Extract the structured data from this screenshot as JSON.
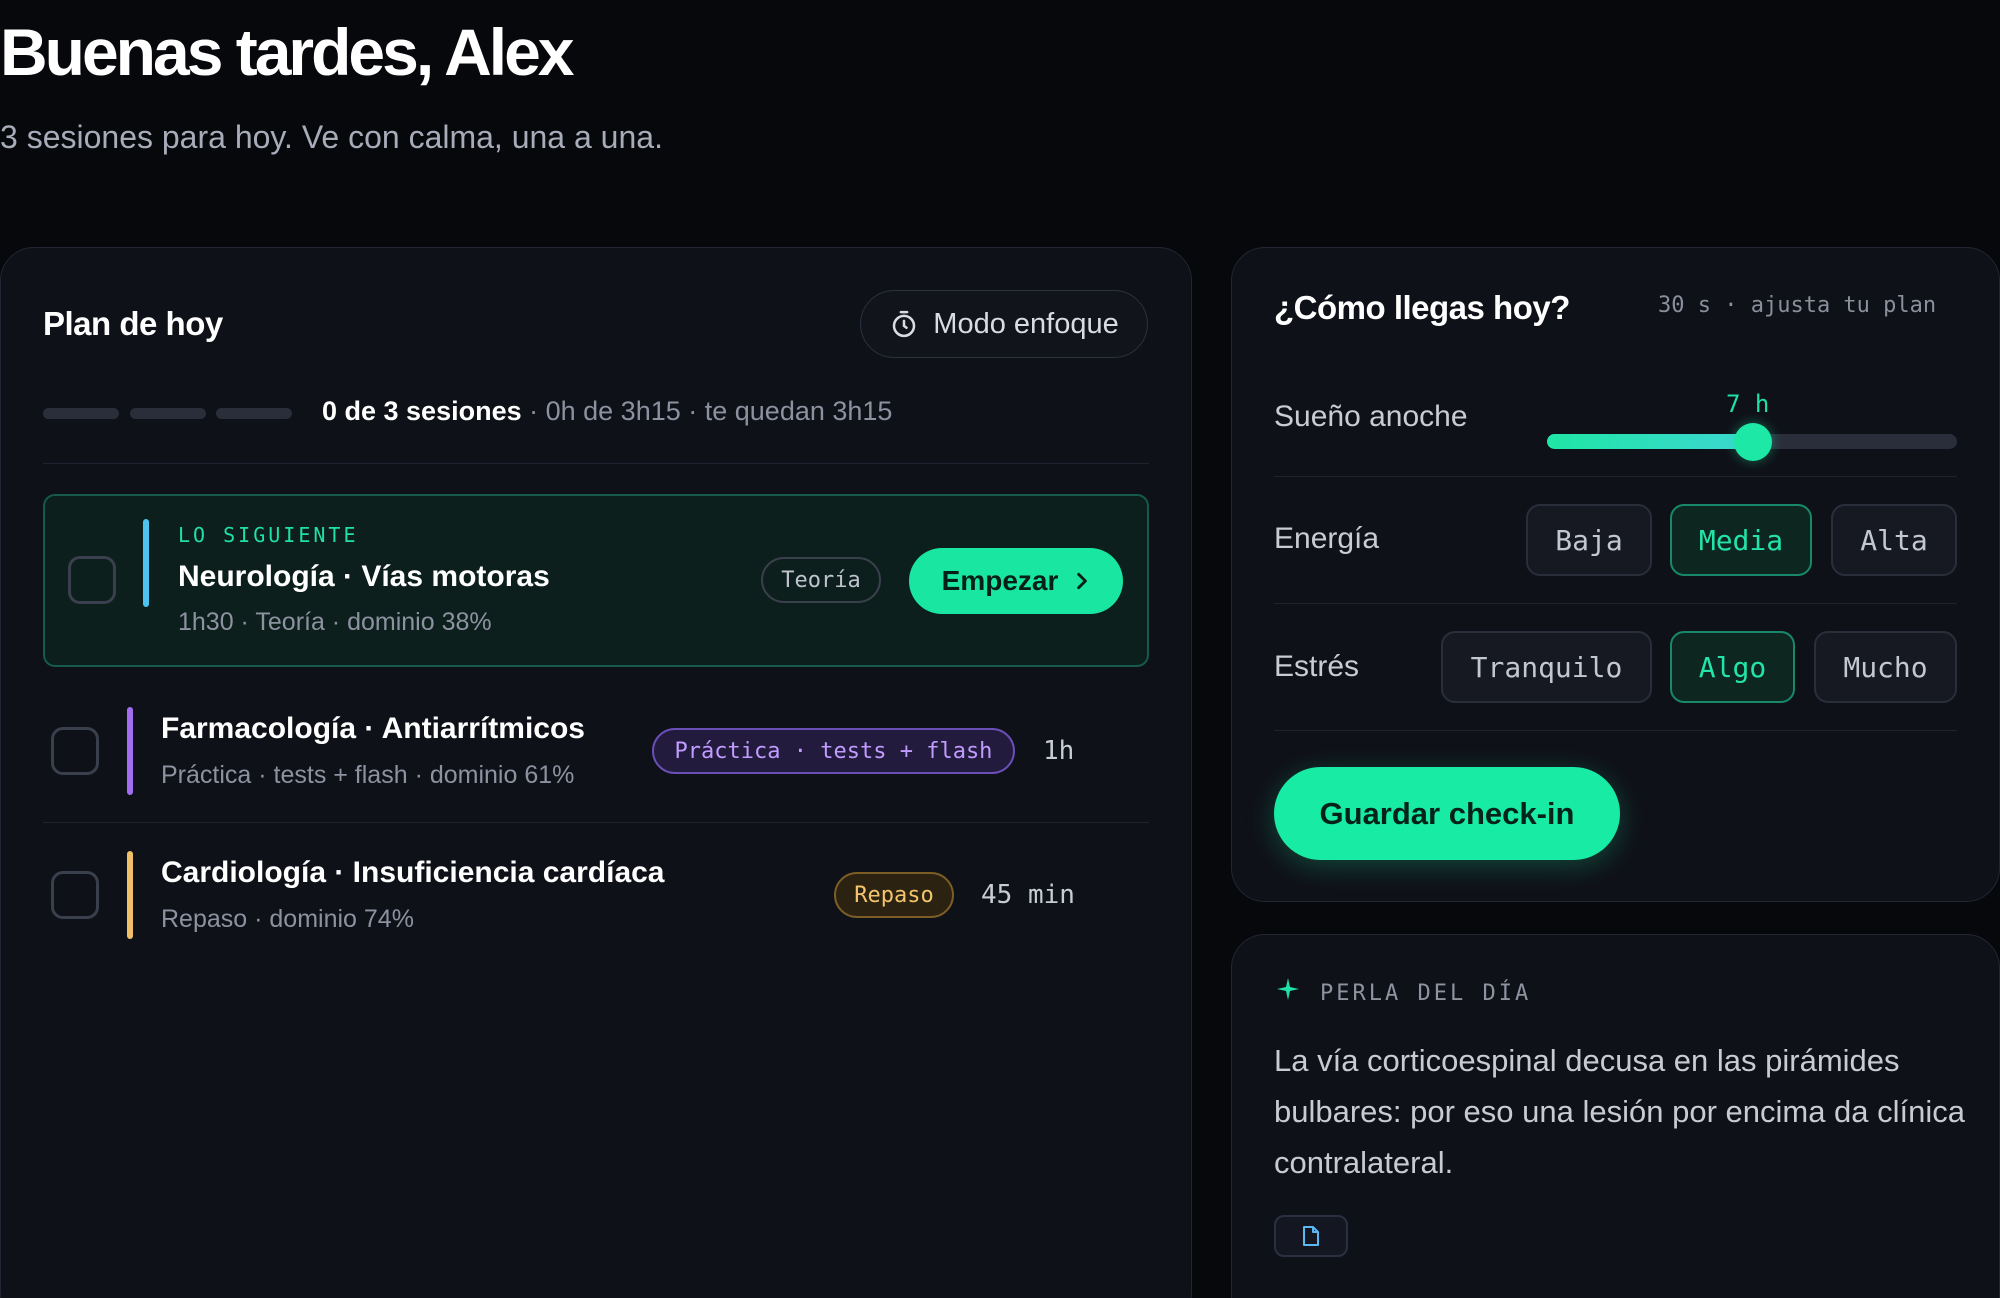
{
  "header": {
    "greeting": "Buenas tardes, Alex",
    "subtitle": "3 sesiones para hoy. Ve con calma, una a una."
  },
  "plan": {
    "title": "Plan de hoy",
    "focus_label": "Modo enfoque",
    "focus_icon": "timer-icon",
    "progress": {
      "count_text": "0 de 3 sesiones",
      "detail_text": " · 0h de 3h15 · te quedan 3h15",
      "completed": 0,
      "total": 3
    },
    "next_eyebrow": "LO SIGUIENTE",
    "start_label": "Empezar",
    "start_icon": "chevron-right-icon",
    "sessions": [
      {
        "title": "Neurología · Vías motoras",
        "meta": "1h30 · Teoría · dominio 38%",
        "tag": "Teoría",
        "accent": "#4cc3f0"
      },
      {
        "title": "Farmacología · Antiarrítmicos",
        "meta": "Práctica · tests + flash · dominio 61%",
        "tag": "Práctica · tests + flash",
        "duration": "1h",
        "accent": "#a36df0"
      },
      {
        "title": "Cardiología · Insuficiencia cardíaca",
        "meta": "Repaso · dominio 74%",
        "tag": "Repaso",
        "duration": "45 min",
        "accent": "#f0c069"
      }
    ]
  },
  "checkin": {
    "title": "¿Cómo llegas hoy?",
    "hint": "30 s · ajusta tu plan",
    "sleep": {
      "label": "Sueño anoche",
      "value_text": "7 h",
      "value": 7
    },
    "energy": {
      "label": "Energía",
      "options": [
        "Baja",
        "Media",
        "Alta"
      ],
      "selected": "Media"
    },
    "stress": {
      "label": "Estrés",
      "options": [
        "Tranquilo",
        "Algo",
        "Mucho"
      ],
      "selected": "Algo"
    },
    "save_label": "Guardar check-in"
  },
  "perla": {
    "eyebrow": "PERLA DEL DÍA",
    "icon": "sparkle-icon",
    "text": "La vía corticoespinal decusa en las pirámides bulbares: por eso una lesión por encima da clínica contralateral.",
    "doc_icon": "document-icon"
  },
  "colors": {
    "accent": "#19e6a1",
    "background": "#07080c",
    "card": "#0f1118"
  }
}
